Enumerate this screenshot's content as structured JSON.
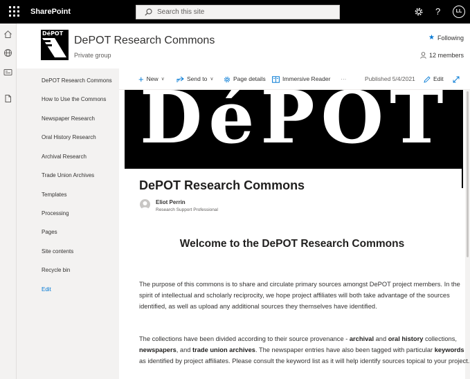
{
  "suite": {
    "app_name": "SharePoint",
    "search_placeholder": "Search this site",
    "help_label": "?",
    "avatar_initials": "LL"
  },
  "site": {
    "logo_text": "DéPOT",
    "title": "DePOT Research Commons",
    "subtitle": "Private group",
    "following_label": "Following",
    "members_label": "12 members"
  },
  "nav": {
    "items": [
      "DePOT Research Commons",
      "How to Use the Commons",
      "Newspaper Research",
      "Oral History Research",
      "Archival Research",
      "Trade Union Archives",
      "Templates",
      "Processing",
      "Pages",
      "Site contents",
      "Recycle bin"
    ],
    "edit_label": "Edit"
  },
  "commands": {
    "new_label": "New",
    "send_label": "Send to",
    "details_label": "Page details",
    "reader_label": "Immersive Reader",
    "more_label": "···",
    "published_label": "Published 5/4/2021",
    "edit_label": "Edit"
  },
  "page": {
    "banner_text": "DéPOT",
    "title": "DePOT Research Commons",
    "author_name": "Eliot Perrin",
    "author_role": "Research Support Professional",
    "welcome_heading": "Welcome to the DePOT Research Commons",
    "para1": "The purpose of this commons is to share and circulate primary sources amongst DePOT project members. In the spirit of intellectual and scholarly reciprocity, we hope project affiliates will both take advantage of the sources identified, as well as upload any additional sources they themselves have identified.",
    "para2": {
      "t1": "The collections have been divided according to their source provenance - ",
      "k1": "archival",
      "t2": " and ",
      "k2": "oral history",
      "t3": " collections, ",
      "k3": "newspapers",
      "t4": ", and ",
      "k4": "trade union archives",
      "t5": ". The newspaper entries have also been tagged with particular ",
      "k5": "keywords",
      "t6": " as identified by project affiliates. Please consult the keyword list as it will help identify sources topical to your project."
    }
  },
  "colors": {
    "accent": "#0078d4",
    "suitebar": "#000000",
    "nav_bg": "#f3f2f1"
  }
}
